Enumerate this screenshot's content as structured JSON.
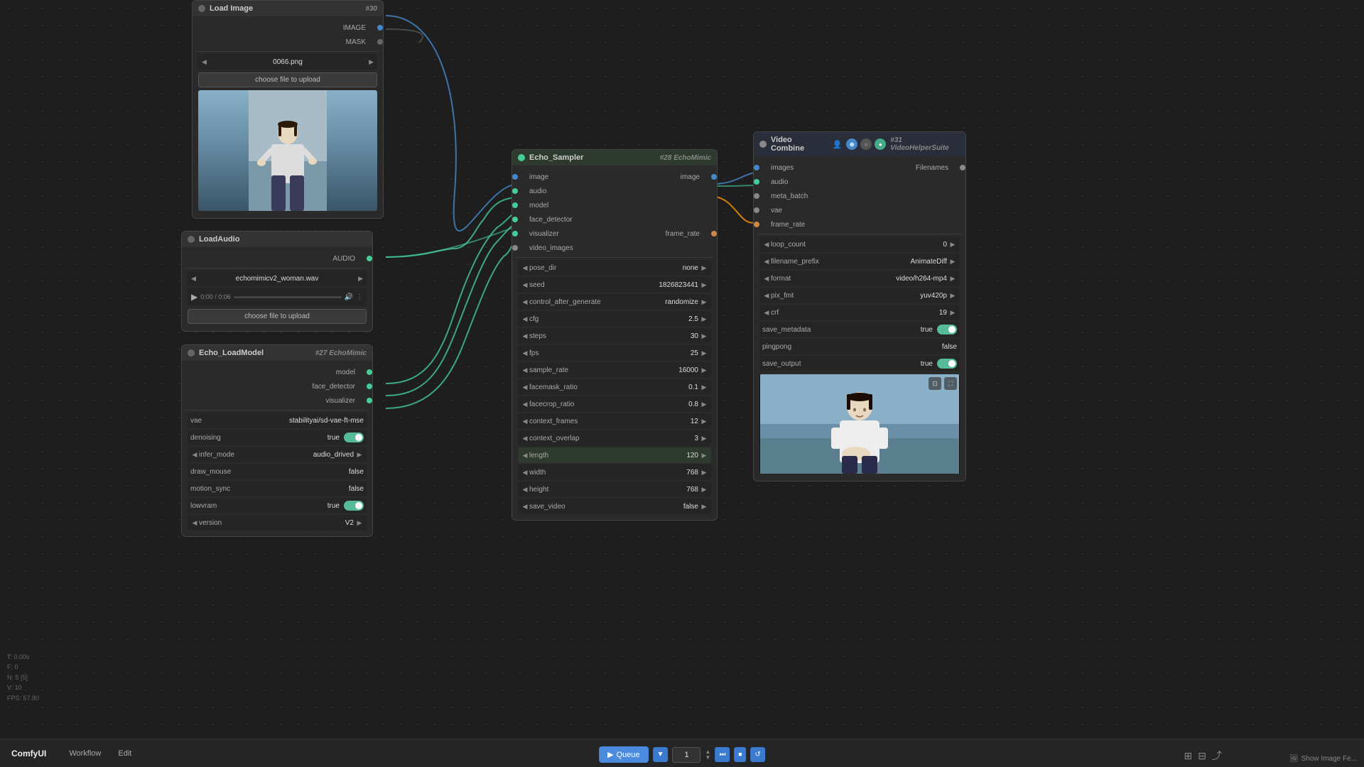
{
  "app": {
    "title": "ComfyUI",
    "workflow_label": "Workflow",
    "edit_label": "Edit"
  },
  "stats": {
    "T": "T: 0.00s",
    "F": "F: 0",
    "N": "N: 5 [5]",
    "V": "V: 10",
    "FPS": "FPS: 57.80"
  },
  "nodes": {
    "load_image": {
      "id": "#30",
      "title": "Load Image",
      "image_file": "0066.png",
      "upload_btn": "choose file to upload",
      "ports_out": [
        "IMAGE",
        "MASK"
      ]
    },
    "load_audio": {
      "id": "",
      "title": "LoadAudio",
      "audio_file": "echomimicv2_woman.wav",
      "upload_btn": "choose file to upload",
      "time": "0:00 / 0:06",
      "port_out": "AUDIO"
    },
    "echo_model": {
      "id": "#27 EchoMimic",
      "title": "Echo_LoadModel",
      "vae": "stabilityai/sd-vae-ft-mse",
      "denoising": "true",
      "infer_mode": "audio_drived",
      "draw_mouse": "false",
      "motion_sync": "false",
      "lowvram": "true",
      "version": "V2",
      "ports_out": [
        "model",
        "face_detector",
        "visualizer"
      ]
    },
    "echo_sampler": {
      "id": "#28 EchoMimic",
      "title": "Echo_Sampler",
      "ports_in": [
        "image",
        "audio",
        "model",
        "face_detector",
        "visualizer",
        "video_images"
      ],
      "ports_out": [
        "image",
        "frame_rate"
      ],
      "pose_dir": "none",
      "seed": "1826823441",
      "control_after_generate": "randomize",
      "cfg": "2.5",
      "steps": "30",
      "fps": "25",
      "sample_rate": "16000",
      "facemask_ratio": "0.1",
      "facecrop_ratio": "0.8",
      "context_frames": "12",
      "context_overlap": "3",
      "length": "120",
      "width": "768",
      "height": "768",
      "save_video": "false"
    },
    "video_combine": {
      "id": "#31 VideoHelperSuite",
      "title": "Video Combine",
      "ports_in": [
        "images",
        "audio",
        "meta_batch",
        "vae",
        "frame_rate"
      ],
      "ports_out": [
        "Filenames"
      ],
      "loop_count": "0",
      "filename_prefix": "AnimateDiff",
      "format": "video/h264-mp4",
      "pix_fmt": "yuv420p",
      "crf": "19",
      "save_metadata": "true",
      "pingpong": "false",
      "save_output": "true"
    }
  },
  "queue": {
    "btn_label": "Queue",
    "count": "1"
  },
  "bottom": {
    "show_feed": "Show Image Fe...",
    "workflow": "Workflow",
    "edit": "Edit"
  },
  "icons": {
    "play": "▶",
    "arrow_left": "◀",
    "arrow_right": "▶",
    "arrow_up": "▲",
    "arrow_down": "▼",
    "volume": "🔊",
    "more": "⋮",
    "queue_play": "▶"
  }
}
